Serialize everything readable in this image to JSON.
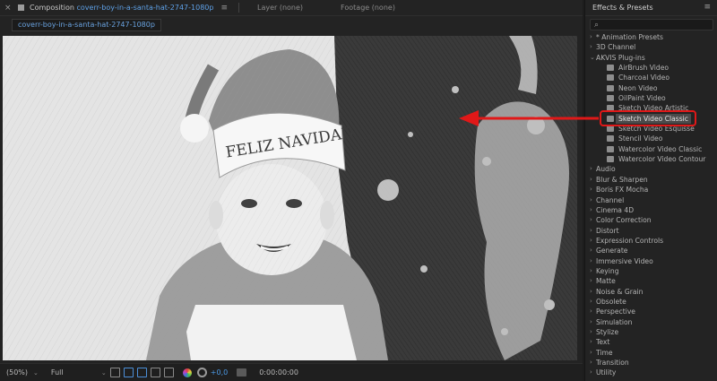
{
  "composition_panel": {
    "tab_prefix": "Composition",
    "comp_name": "coverr-boy-in-a-santa-hat-2747-1080p",
    "layer_tab": "Layer (none)",
    "footage_tab": "Footage (none)",
    "comp_chip": "coverr-boy-in-a-santa-hat-2747-1080p"
  },
  "viewer": {
    "hat_text": "FELIZ NAVIDAD"
  },
  "bottom_bar": {
    "zoom": "(50%)",
    "resolution": "Full",
    "exposure": "+0,0",
    "timecode": "0:00:00:00"
  },
  "effects_panel": {
    "title": "Effects & Presets",
    "search_placeholder": "",
    "items": [
      {
        "label": "* Animation Presets",
        "chevron": "›"
      },
      {
        "label": "3D Channel",
        "chevron": "›"
      },
      {
        "label": "AKVIS Plug-ins",
        "chevron": "⌄"
      },
      {
        "label": "AirBrush Video"
      },
      {
        "label": "Charcoal Video"
      },
      {
        "label": "Neon Video"
      },
      {
        "label": "OilPaint Video"
      },
      {
        "label": "Sketch Video Artistic"
      },
      {
        "label": "Sketch Video Classic"
      },
      {
        "label": "Sketch Video Esquisse"
      },
      {
        "label": "Stencil Video"
      },
      {
        "label": "Watercolor Video Classic"
      },
      {
        "label": "Watercolor Video Contour"
      },
      {
        "label": "Audio",
        "chevron": "›"
      },
      {
        "label": "Blur & Sharpen",
        "chevron": "›"
      },
      {
        "label": "Boris FX Mocha",
        "chevron": "›"
      },
      {
        "label": "Channel",
        "chevron": "›"
      },
      {
        "label": "Cinema 4D",
        "chevron": "›"
      },
      {
        "label": "Color Correction",
        "chevron": "›"
      },
      {
        "label": "Distort",
        "chevron": "›"
      },
      {
        "label": "Expression Controls",
        "chevron": "›"
      },
      {
        "label": "Generate",
        "chevron": "›"
      },
      {
        "label": "Immersive Video",
        "chevron": "›"
      },
      {
        "label": "Keying",
        "chevron": "›"
      },
      {
        "label": "Matte",
        "chevron": "›"
      },
      {
        "label": "Noise & Grain",
        "chevron": "›"
      },
      {
        "label": "Obsolete",
        "chevron": "›"
      },
      {
        "label": "Perspective",
        "chevron": "›"
      },
      {
        "label": "Simulation",
        "chevron": "›"
      },
      {
        "label": "Stylize",
        "chevron": "›"
      },
      {
        "label": "Text",
        "chevron": "›"
      },
      {
        "label": "Time",
        "chevron": "›"
      },
      {
        "label": "Transition",
        "chevron": "›"
      },
      {
        "label": "Utility",
        "chevron": "›"
      }
    ]
  },
  "colors": {
    "accent_blue": "#5ea0e6",
    "annotation_red": "#e01818",
    "panel_bg": "#232323"
  }
}
